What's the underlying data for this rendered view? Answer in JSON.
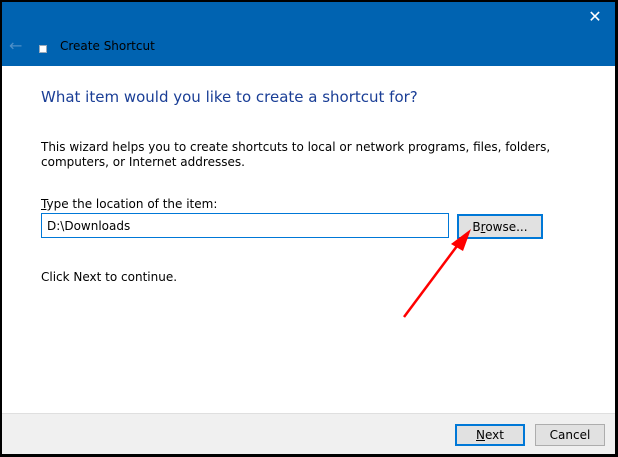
{
  "window": {
    "title": "Create Shortcut",
    "close_icon": "close-icon",
    "back_icon": "back-arrow-icon"
  },
  "main": {
    "heading": "What item would you like to create a shortcut for?",
    "description": "This wizard helps you to create shortcuts to local or network programs, files, folders, computers, or Internet addresses.",
    "location_label_accel": "T",
    "location_label_rest": "ype the location of the item:",
    "location_value": "D:\\Downloads",
    "browse_pre": "B",
    "browse_accel": "r",
    "browse_post": "owse...",
    "continue_text": "Click Next to continue."
  },
  "footer": {
    "next_accel": "N",
    "next_rest": "ext",
    "cancel_label": "Cancel"
  },
  "annotation": {
    "arrow_color": "#ff0000"
  }
}
